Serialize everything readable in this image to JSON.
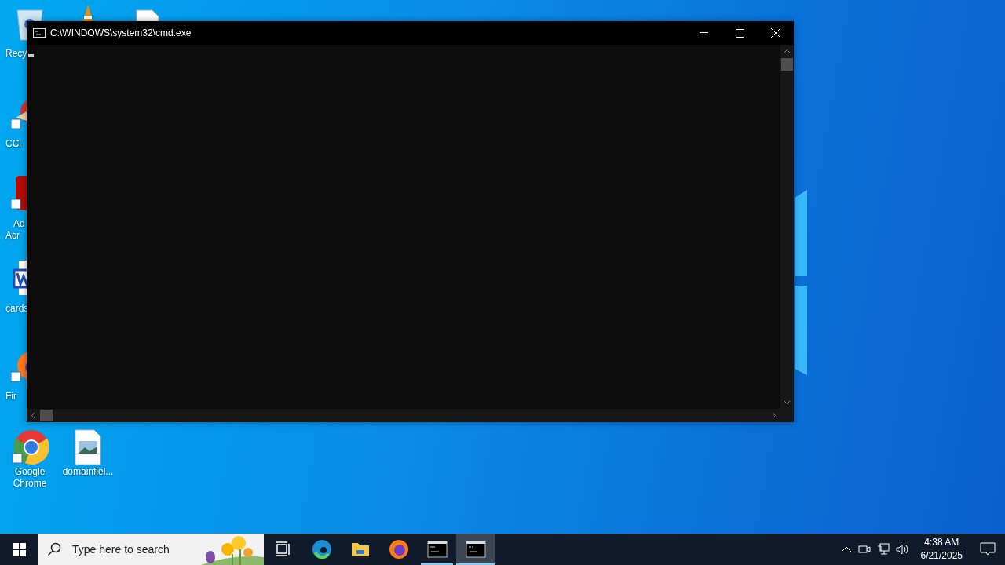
{
  "desktop": {
    "icons": [
      {
        "kind": "recycle",
        "lines": [
          "Recy"
        ]
      },
      {
        "kind": "vlc"
      },
      {
        "kind": "doc"
      },
      {
        "kind": "ccleaner",
        "lines": [
          "CCl"
        ]
      },
      {
        "kind": "acrobat",
        "lines": [
          "Ad",
          "Acr"
        ]
      },
      {
        "kind": "word",
        "lines": [
          "cards"
        ]
      },
      {
        "kind": "firefox",
        "lines": [
          "Fir"
        ]
      },
      {
        "kind": "chrome",
        "lines": [
          "Google",
          "Chrome"
        ]
      },
      {
        "kind": "image",
        "lines": [
          "domainfiel..."
        ]
      }
    ]
  },
  "window": {
    "title": "C:\\WINDOWS\\system32\\cmd.exe"
  },
  "taskbar": {
    "search": {
      "placeholder": "Type here to search"
    },
    "apps": [
      {
        "kind": "taskview",
        "running": false,
        "selected": false
      },
      {
        "kind": "edge",
        "running": false,
        "selected": false
      },
      {
        "kind": "explorer",
        "running": false,
        "selected": false
      },
      {
        "kind": "firefox",
        "running": false,
        "selected": false
      },
      {
        "kind": "cmd",
        "running": true,
        "selected": false
      },
      {
        "kind": "cmd",
        "running": true,
        "selected": true
      }
    ],
    "clock": {
      "time": "4:38 AM",
      "date": "6/21/2025"
    }
  }
}
